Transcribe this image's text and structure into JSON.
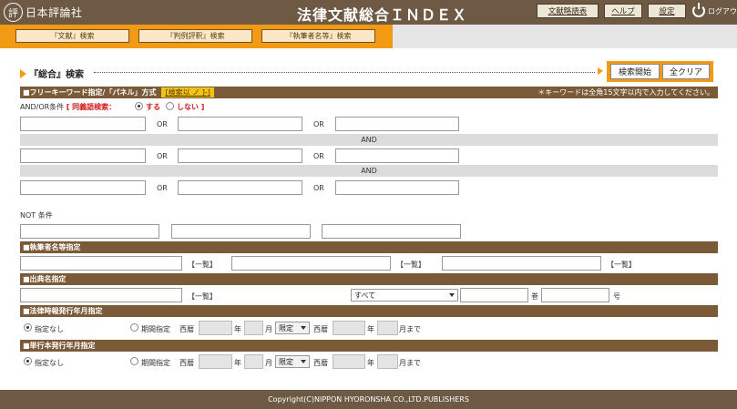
{
  "header": {
    "logo_text": "日本評論社",
    "logo_glyph": "評",
    "site_title": "法律文献総合ＩＮＤＥＸ",
    "buttons": [
      "文献略語表",
      "ヘルプ",
      "設定"
    ],
    "logout": "ログアウ"
  },
  "tabs": [
    "『文献』検索",
    "『判例評釈』検索",
    "『執筆者名等』検索"
  ],
  "section": {
    "title": "『総合』検索",
    "search_button": "検索開始",
    "clear_button": "全クリア"
  },
  "freeword": {
    "bar_label": "■フリーキーワード指定/「パネル」方式",
    "change_label": "[検索以 ノ ]-]",
    "note": "＊キーワードは全角15文字以内で入力してください。",
    "andor_label": "AND/OR条件",
    "synonym_label": "[ 同義語検索：",
    "radio_yes": "する",
    "radio_no": "しない ]",
    "or": "OR",
    "and": "AND",
    "not_label": "NOT 条件"
  },
  "author": {
    "bar_label": "■執筆者名等指定",
    "list_label": "【一覧】"
  },
  "publication": {
    "bar_label": "■出典名指定",
    "list_label": "【一覧】",
    "select_value": "すべて",
    "vol_label": "巻",
    "num_label": "号"
  },
  "houritsu": {
    "bar_label": "■法律時報発行年月指定",
    "none_label": "指定なし",
    "period_label": "期間指定",
    "era_label": "西暦",
    "year_label": "年",
    "month_label": "月",
    "select_value": "限定",
    "until_label": "月まで"
  },
  "tankobon": {
    "bar_label": "■単行本発行年月指定",
    "none_label": "指定なし",
    "period_label": "期間指定",
    "era_label": "西暦",
    "year_label": "年",
    "month_label": "月",
    "select_value": "限定",
    "until_label": "月まで"
  },
  "footer": "Copyright(C)NIPPON HYORONSHA CO.,LTD.PUBLISHERS"
}
